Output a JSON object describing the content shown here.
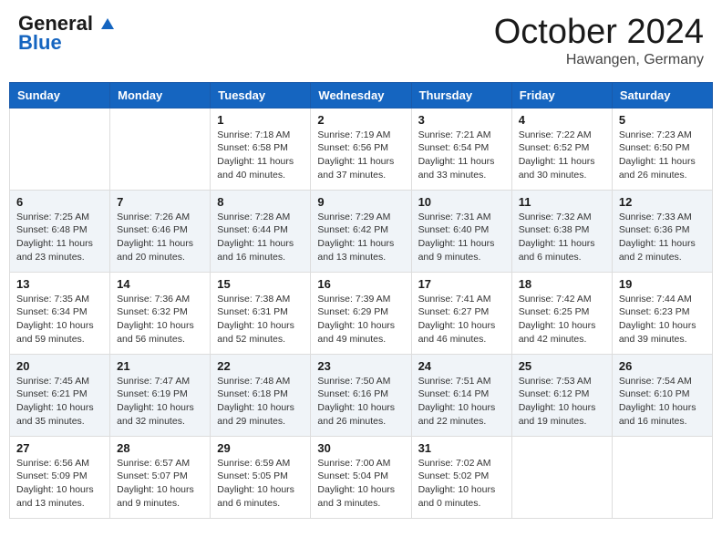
{
  "header": {
    "logo_general": "General",
    "logo_blue": "Blue",
    "month_title": "October 2024",
    "location": "Hawangen, Germany"
  },
  "days_of_week": [
    "Sunday",
    "Monday",
    "Tuesday",
    "Wednesday",
    "Thursday",
    "Friday",
    "Saturday"
  ],
  "weeks": [
    [
      {
        "day": null
      },
      {
        "day": null
      },
      {
        "day": "1",
        "sunrise": "Sunrise: 7:18 AM",
        "sunset": "Sunset: 6:58 PM",
        "daylight": "Daylight: 11 hours and 40 minutes."
      },
      {
        "day": "2",
        "sunrise": "Sunrise: 7:19 AM",
        "sunset": "Sunset: 6:56 PM",
        "daylight": "Daylight: 11 hours and 37 minutes."
      },
      {
        "day": "3",
        "sunrise": "Sunrise: 7:21 AM",
        "sunset": "Sunset: 6:54 PM",
        "daylight": "Daylight: 11 hours and 33 minutes."
      },
      {
        "day": "4",
        "sunrise": "Sunrise: 7:22 AM",
        "sunset": "Sunset: 6:52 PM",
        "daylight": "Daylight: 11 hours and 30 minutes."
      },
      {
        "day": "5",
        "sunrise": "Sunrise: 7:23 AM",
        "sunset": "Sunset: 6:50 PM",
        "daylight": "Daylight: 11 hours and 26 minutes."
      }
    ],
    [
      {
        "day": "6",
        "sunrise": "Sunrise: 7:25 AM",
        "sunset": "Sunset: 6:48 PM",
        "daylight": "Daylight: 11 hours and 23 minutes."
      },
      {
        "day": "7",
        "sunrise": "Sunrise: 7:26 AM",
        "sunset": "Sunset: 6:46 PM",
        "daylight": "Daylight: 11 hours and 20 minutes."
      },
      {
        "day": "8",
        "sunrise": "Sunrise: 7:28 AM",
        "sunset": "Sunset: 6:44 PM",
        "daylight": "Daylight: 11 hours and 16 minutes."
      },
      {
        "day": "9",
        "sunrise": "Sunrise: 7:29 AM",
        "sunset": "Sunset: 6:42 PM",
        "daylight": "Daylight: 11 hours and 13 minutes."
      },
      {
        "day": "10",
        "sunrise": "Sunrise: 7:31 AM",
        "sunset": "Sunset: 6:40 PM",
        "daylight": "Daylight: 11 hours and 9 minutes."
      },
      {
        "day": "11",
        "sunrise": "Sunrise: 7:32 AM",
        "sunset": "Sunset: 6:38 PM",
        "daylight": "Daylight: 11 hours and 6 minutes."
      },
      {
        "day": "12",
        "sunrise": "Sunrise: 7:33 AM",
        "sunset": "Sunset: 6:36 PM",
        "daylight": "Daylight: 11 hours and 2 minutes."
      }
    ],
    [
      {
        "day": "13",
        "sunrise": "Sunrise: 7:35 AM",
        "sunset": "Sunset: 6:34 PM",
        "daylight": "Daylight: 10 hours and 59 minutes."
      },
      {
        "day": "14",
        "sunrise": "Sunrise: 7:36 AM",
        "sunset": "Sunset: 6:32 PM",
        "daylight": "Daylight: 10 hours and 56 minutes."
      },
      {
        "day": "15",
        "sunrise": "Sunrise: 7:38 AM",
        "sunset": "Sunset: 6:31 PM",
        "daylight": "Daylight: 10 hours and 52 minutes."
      },
      {
        "day": "16",
        "sunrise": "Sunrise: 7:39 AM",
        "sunset": "Sunset: 6:29 PM",
        "daylight": "Daylight: 10 hours and 49 minutes."
      },
      {
        "day": "17",
        "sunrise": "Sunrise: 7:41 AM",
        "sunset": "Sunset: 6:27 PM",
        "daylight": "Daylight: 10 hours and 46 minutes."
      },
      {
        "day": "18",
        "sunrise": "Sunrise: 7:42 AM",
        "sunset": "Sunset: 6:25 PM",
        "daylight": "Daylight: 10 hours and 42 minutes."
      },
      {
        "day": "19",
        "sunrise": "Sunrise: 7:44 AM",
        "sunset": "Sunset: 6:23 PM",
        "daylight": "Daylight: 10 hours and 39 minutes."
      }
    ],
    [
      {
        "day": "20",
        "sunrise": "Sunrise: 7:45 AM",
        "sunset": "Sunset: 6:21 PM",
        "daylight": "Daylight: 10 hours and 35 minutes."
      },
      {
        "day": "21",
        "sunrise": "Sunrise: 7:47 AM",
        "sunset": "Sunset: 6:19 PM",
        "daylight": "Daylight: 10 hours and 32 minutes."
      },
      {
        "day": "22",
        "sunrise": "Sunrise: 7:48 AM",
        "sunset": "Sunset: 6:18 PM",
        "daylight": "Daylight: 10 hours and 29 minutes."
      },
      {
        "day": "23",
        "sunrise": "Sunrise: 7:50 AM",
        "sunset": "Sunset: 6:16 PM",
        "daylight": "Daylight: 10 hours and 26 minutes."
      },
      {
        "day": "24",
        "sunrise": "Sunrise: 7:51 AM",
        "sunset": "Sunset: 6:14 PM",
        "daylight": "Daylight: 10 hours and 22 minutes."
      },
      {
        "day": "25",
        "sunrise": "Sunrise: 7:53 AM",
        "sunset": "Sunset: 6:12 PM",
        "daylight": "Daylight: 10 hours and 19 minutes."
      },
      {
        "day": "26",
        "sunrise": "Sunrise: 7:54 AM",
        "sunset": "Sunset: 6:10 PM",
        "daylight": "Daylight: 10 hours and 16 minutes."
      }
    ],
    [
      {
        "day": "27",
        "sunrise": "Sunrise: 6:56 AM",
        "sunset": "Sunset: 5:09 PM",
        "daylight": "Daylight: 10 hours and 13 minutes."
      },
      {
        "day": "28",
        "sunrise": "Sunrise: 6:57 AM",
        "sunset": "Sunset: 5:07 PM",
        "daylight": "Daylight: 10 hours and 9 minutes."
      },
      {
        "day": "29",
        "sunrise": "Sunrise: 6:59 AM",
        "sunset": "Sunset: 5:05 PM",
        "daylight": "Daylight: 10 hours and 6 minutes."
      },
      {
        "day": "30",
        "sunrise": "Sunrise: 7:00 AM",
        "sunset": "Sunset: 5:04 PM",
        "daylight": "Daylight: 10 hours and 3 minutes."
      },
      {
        "day": "31",
        "sunrise": "Sunrise: 7:02 AM",
        "sunset": "Sunset: 5:02 PM",
        "daylight": "Daylight: 10 hours and 0 minutes."
      },
      {
        "day": null
      },
      {
        "day": null
      }
    ]
  ]
}
